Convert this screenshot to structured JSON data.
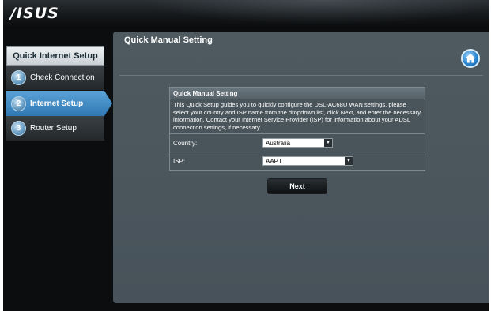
{
  "brand": {
    "logo_text": "/ISUS"
  },
  "sidebar": {
    "title": "Quick Internet Setup",
    "steps": [
      {
        "number": "1",
        "label": "Check Connection",
        "active": false
      },
      {
        "number": "2",
        "label": "Internet Setup",
        "active": true
      },
      {
        "number": "3",
        "label": "Router Setup",
        "active": false
      }
    ]
  },
  "main": {
    "title": "Quick Manual Setting",
    "home_icon": "home-icon",
    "panel": {
      "title": "Quick Manual Setting",
      "description": "This Quick Setup guides you to quickly configure the DSL-AC68U WAN settings, please select your country and ISP name from the dropdown list, click Next, and enter the necessary information. Contact your Internet Service Provider (ISP) for information about your ADSL connection settings, if necessary.",
      "country_label": "Country:",
      "country_value": "Australia",
      "isp_label": "ISP:",
      "isp_value": "AAPT"
    },
    "next_label": "Next"
  },
  "colors": {
    "accent": "#2f78b4",
    "panel_bg": "#4a555b",
    "main_bg": "#4f5a60"
  }
}
